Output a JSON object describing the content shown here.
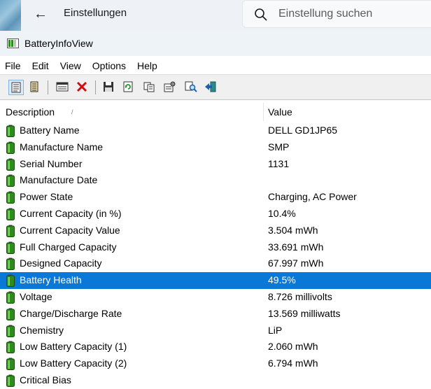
{
  "settings": {
    "back_icon": "arrow-left-icon",
    "title": "Einstellungen",
    "search_placeholder": "Einstellung suchen"
  },
  "window": {
    "title": "BatteryInfoView"
  },
  "menu": [
    "File",
    "Edit",
    "View",
    "Options",
    "Help"
  ],
  "toolbar": [
    {
      "icon": "battery-info-mode-icon",
      "selected": true
    },
    {
      "icon": "battery-log-mode-icon",
      "selected": false
    },
    {
      "icon": "log-window-icon",
      "selected": false
    },
    {
      "icon": "delete-icon",
      "selected": false
    },
    {
      "icon": "save-icon",
      "selected": false
    },
    {
      "icon": "refresh-icon",
      "selected": false
    },
    {
      "icon": "copy-icon",
      "selected": false
    },
    {
      "icon": "properties-icon",
      "selected": false
    },
    {
      "icon": "find-icon",
      "selected": false
    },
    {
      "icon": "exit-icon",
      "selected": false
    }
  ],
  "columns": {
    "description": "Description",
    "value": "Value"
  },
  "rows": [
    {
      "d": "Battery Name",
      "v": "DELL GD1JP65"
    },
    {
      "d": "Manufacture Name",
      "v": "SMP"
    },
    {
      "d": "Serial Number",
      "v": "1131"
    },
    {
      "d": "Manufacture Date",
      "v": ""
    },
    {
      "d": "Power State",
      "v": "Charging, AC Power"
    },
    {
      "d": "Current Capacity (in %)",
      "v": "10.4%"
    },
    {
      "d": "Current Capacity Value",
      "v": "3.504 mWh"
    },
    {
      "d": "Full Charged Capacity",
      "v": "33.691 mWh"
    },
    {
      "d": "Designed Capacity",
      "v": "67.997 mWh"
    },
    {
      "d": "Battery Health",
      "v": "49.5%"
    },
    {
      "d": "Voltage",
      "v": "8.726 millivolts"
    },
    {
      "d": "Charge/Discharge Rate",
      "v": "13.569 milliwatts"
    },
    {
      "d": "Chemistry",
      "v": "LiP"
    },
    {
      "d": "Low Battery Capacity (1)",
      "v": "2.060 mWh"
    },
    {
      "d": "Low Battery Capacity (2)",
      "v": "6.794 mWh"
    },
    {
      "d": "Critical Bias",
      "v": ""
    }
  ],
  "selected_row": "Battery Health",
  "colors": {
    "selection": "#0a78d7",
    "battery_green": "#2e8b1e"
  }
}
